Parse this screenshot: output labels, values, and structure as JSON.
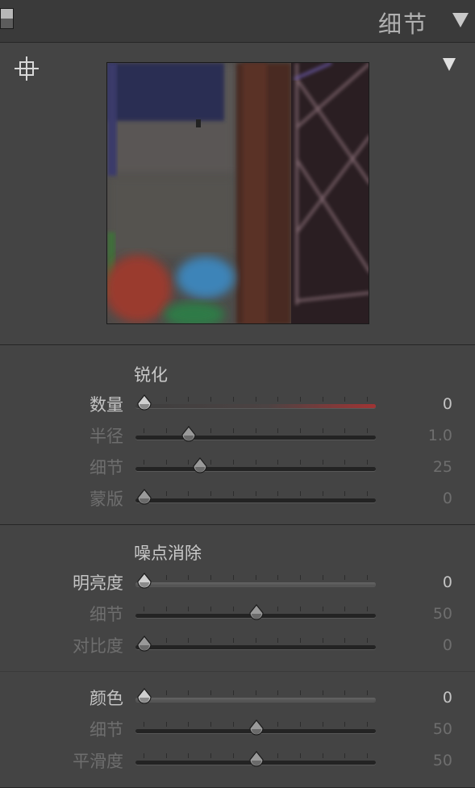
{
  "panel": {
    "title": "细节",
    "collapse_icon": "triangle-down-icon",
    "toggle_icon": "panel-switch-icon",
    "target_icon": "crosshair-target-icon",
    "preview_menu_icon": "triangle-down-icon"
  },
  "preview": {
    "description_icon": "detail-preview-image"
  },
  "sharpening": {
    "title": "锐化",
    "sliders": [
      {
        "label": "数量",
        "value": "0",
        "min": 0,
        "max": 150,
        "num": 0,
        "active": true,
        "red": true
      },
      {
        "label": "半径",
        "value": "1.0",
        "min": 0.5,
        "max": 3.0,
        "num": 1.0,
        "active": false
      },
      {
        "label": "细节",
        "value": "25",
        "min": 0,
        "max": 100,
        "num": 25,
        "active": false
      },
      {
        "label": "蒙版",
        "value": "0",
        "min": 0,
        "max": 100,
        "num": 0,
        "active": false
      }
    ]
  },
  "noise": {
    "title": "噪点消除",
    "luminance": [
      {
        "label": "明亮度",
        "value": "0",
        "min": 0,
        "max": 100,
        "num": 0,
        "active": true
      },
      {
        "label": "细节",
        "value": "50",
        "min": 0,
        "max": 100,
        "num": 50,
        "active": false
      },
      {
        "label": "对比度",
        "value": "0",
        "min": 0,
        "max": 100,
        "num": 0,
        "active": false
      }
    ],
    "color": [
      {
        "label": "颜色",
        "value": "0",
        "min": 0,
        "max": 100,
        "num": 0,
        "active": true
      },
      {
        "label": "细节",
        "value": "50",
        "min": 0,
        "max": 100,
        "num": 50,
        "active": false
      },
      {
        "label": "平滑度",
        "value": "50",
        "min": 0,
        "max": 100,
        "num": 50,
        "active": false
      }
    ]
  },
  "colors": {
    "background": "#444444",
    "accent_red": "#a03434"
  }
}
